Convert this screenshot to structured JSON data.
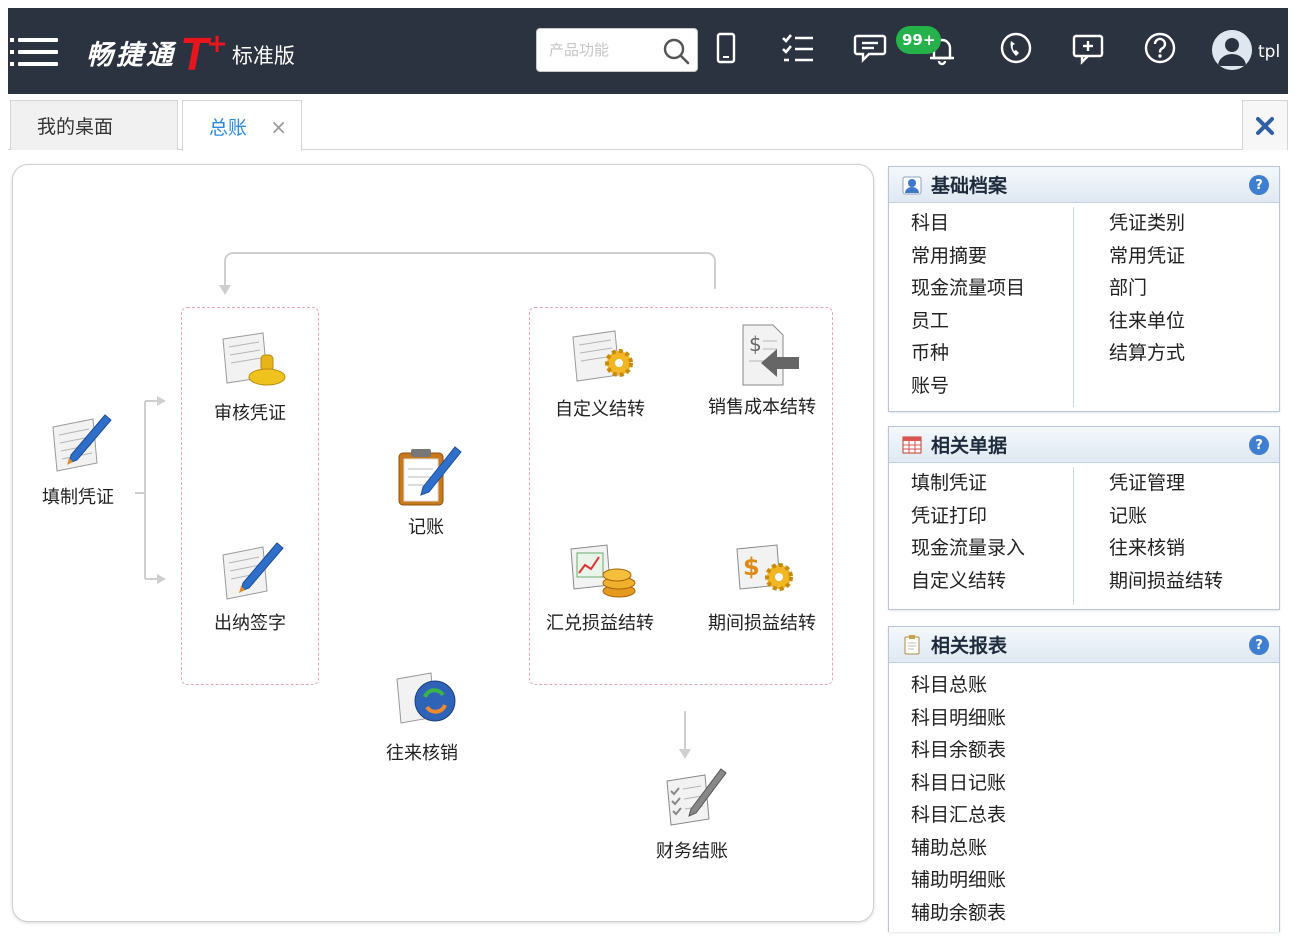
{
  "header": {
    "logo_text": "畅捷通",
    "logo_t": "T",
    "logo_plus": "+",
    "edition": "标准版",
    "search_placeholder": "产品功能",
    "notification_count": "99+",
    "user_name": "tpl",
    "icons": [
      "menu-icon",
      "mobile-icon",
      "task-list-icon",
      "message-icon",
      "bell-icon",
      "phone-icon",
      "feedback-icon",
      "help-icon",
      "user-avatar-icon"
    ]
  },
  "tabs": [
    {
      "label": "我的桌面",
      "active": false
    },
    {
      "label": "总账",
      "active": true,
      "close": "×"
    }
  ],
  "flow": {
    "nodes": {
      "fill_voucher": "填制凭证",
      "audit_voucher": "审核凭证",
      "cashier_sign": "出纳签字",
      "post": "记账",
      "ar_ap_writeoff": "往来核销",
      "custom_transfer": "自定义结转",
      "sales_cost_transfer": "销售成本结转",
      "exchange_pl_transfer": "汇兑损益结转",
      "period_pl_transfer": "期间损益结转",
      "close_books": "财务结账"
    }
  },
  "panels": {
    "basic": {
      "title": "基础档案",
      "left": [
        "科目",
        "常用摘要",
        "现金流量项目",
        "员工",
        "币种",
        "账号"
      ],
      "right": [
        "凭证类别",
        "常用凭证",
        "部门",
        "往来单位",
        "结算方式"
      ]
    },
    "docs": {
      "title": "相关单据",
      "left": [
        "填制凭证",
        "凭证打印",
        "现金流量录入",
        "自定义结转"
      ],
      "right": [
        "凭证管理",
        "记账",
        "往来核销",
        "期间损益结转"
      ]
    },
    "reports": {
      "title": "相关报表",
      "items": [
        "科目总账",
        "科目明细账",
        "科目余额表",
        "科目日记账",
        "科目汇总表",
        "辅助总账",
        "辅助明细账",
        "辅助余额表"
      ]
    },
    "help_label": "?"
  },
  "colors": {
    "topbar": "#2b3340",
    "brand_red": "#e8141e",
    "badge_green": "#25b24a",
    "active_tab": "#2a8adf",
    "panel_border": "#b7c6d8"
  }
}
